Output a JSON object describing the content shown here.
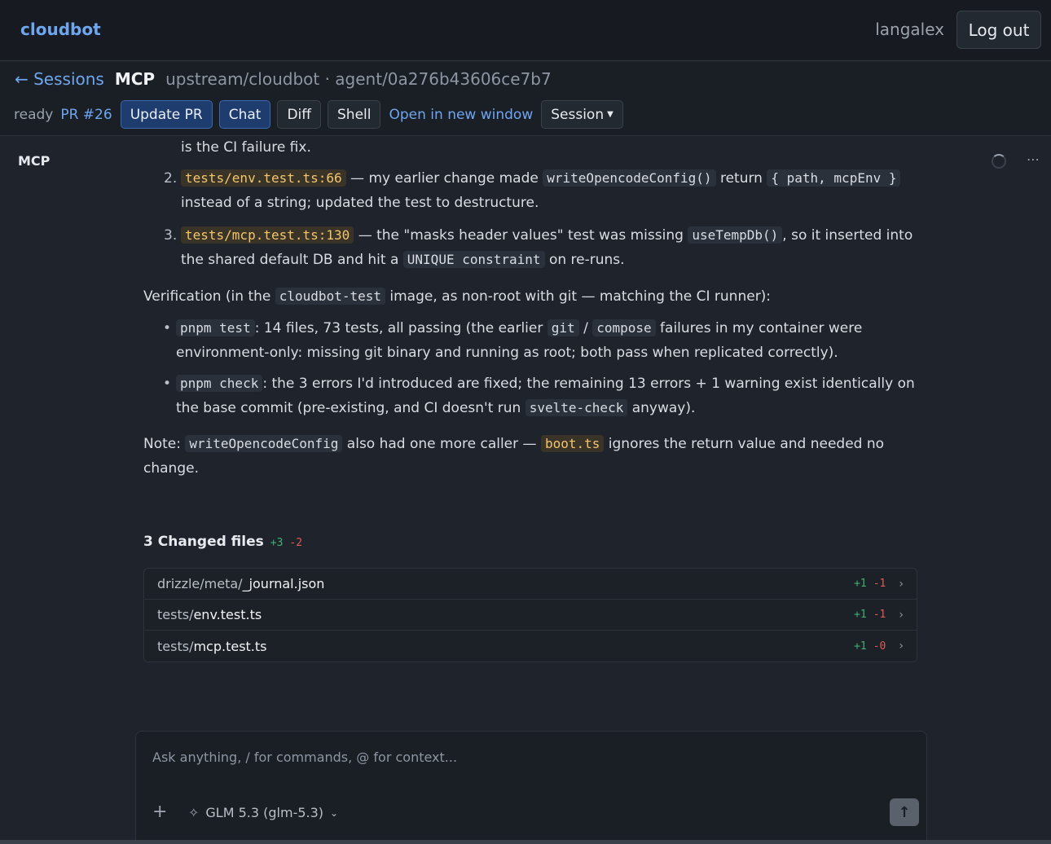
{
  "app": {
    "brand": "cloudbot",
    "user": "langalex",
    "logout_label": "Log out"
  },
  "session": {
    "back_label": "← Sessions",
    "title": "MCP",
    "path": "upstream/cloudbot · agent/0a276b43606ce7b7",
    "status": "ready",
    "pr_label": "PR #26",
    "buttons": {
      "update_pr": "Update PR",
      "chat": "Chat",
      "diff": "Diff",
      "shell": "Shell",
      "open_new_window": "Open in new window",
      "session": "Session"
    }
  },
  "sidebar": {
    "item": "MCP"
  },
  "message": {
    "step1_tail": "is the CI failure fix.",
    "step2": {
      "num": "2.",
      "code1": "tests/env.test.ts:66",
      "t1": " — my earlier change made ",
      "code2": "writeOpencodeConfig()",
      "t2": " return ",
      "code3": "{ path, mcpEnv }",
      "t3": " instead of a string; updated the test to destructure."
    },
    "step3": {
      "num": "3.",
      "code1": "tests/mcp.test.ts:130",
      "t1": " — the \"masks header values\" test was missing ",
      "code2": "useTempDb()",
      "t2": ", so it inserted into the shared default DB and hit a ",
      "code3": "UNIQUE constraint",
      "t3": " on re-runs."
    },
    "verification": {
      "t1": "Verification (in the ",
      "code": "cloudbot-test",
      "t2": " image, as non-root with git — matching the CI runner):"
    },
    "bullet1": {
      "code1": "pnpm test",
      "t1": ": 14 files, 73 tests, all passing (the earlier ",
      "code2": "git",
      "t2": " / ",
      "code3": "compose",
      "t3": " failures in my container were environment-only: missing git binary and running as root; both pass when replicated correctly)."
    },
    "bullet2": {
      "code1": "pnpm check",
      "t1": ": the 3 errors I'd introduced are fixed; the remaining 13 errors + 1 warning exist identically on the base commit (pre-existing, and CI doesn't run ",
      "code2": "svelte-check",
      "t2": " anyway)."
    },
    "note": {
      "t1": "Note: ",
      "code1": "writeOpencodeConfig",
      "t2": " also had one more caller — ",
      "code2": "boot.ts",
      "t3": " ignores the return value and needed no change."
    }
  },
  "changes": {
    "title": "3 Changed files",
    "added": "+3",
    "removed": "-2",
    "files": [
      {
        "dir": "drizzle/meta/",
        "name": "_journal.json",
        "added": "+1",
        "removed": "-1"
      },
      {
        "dir": "tests/",
        "name": "env.test.ts",
        "added": "+1",
        "removed": "-1"
      },
      {
        "dir": "tests/",
        "name": "mcp.test.ts",
        "added": "+1",
        "removed": "-0"
      }
    ]
  },
  "composer": {
    "placeholder": "Ask anything, / for commands, @ for context...",
    "model": "GLM 5.3 (glm-5.3)"
  },
  "icons": {
    "spinner": "loading-spinner-icon",
    "more": "more-horizontal-icon",
    "chevron": "chevron-right-icon",
    "plus": "plus-icon",
    "sparkle": "sparkle-icon",
    "send": "arrow-up-icon"
  }
}
